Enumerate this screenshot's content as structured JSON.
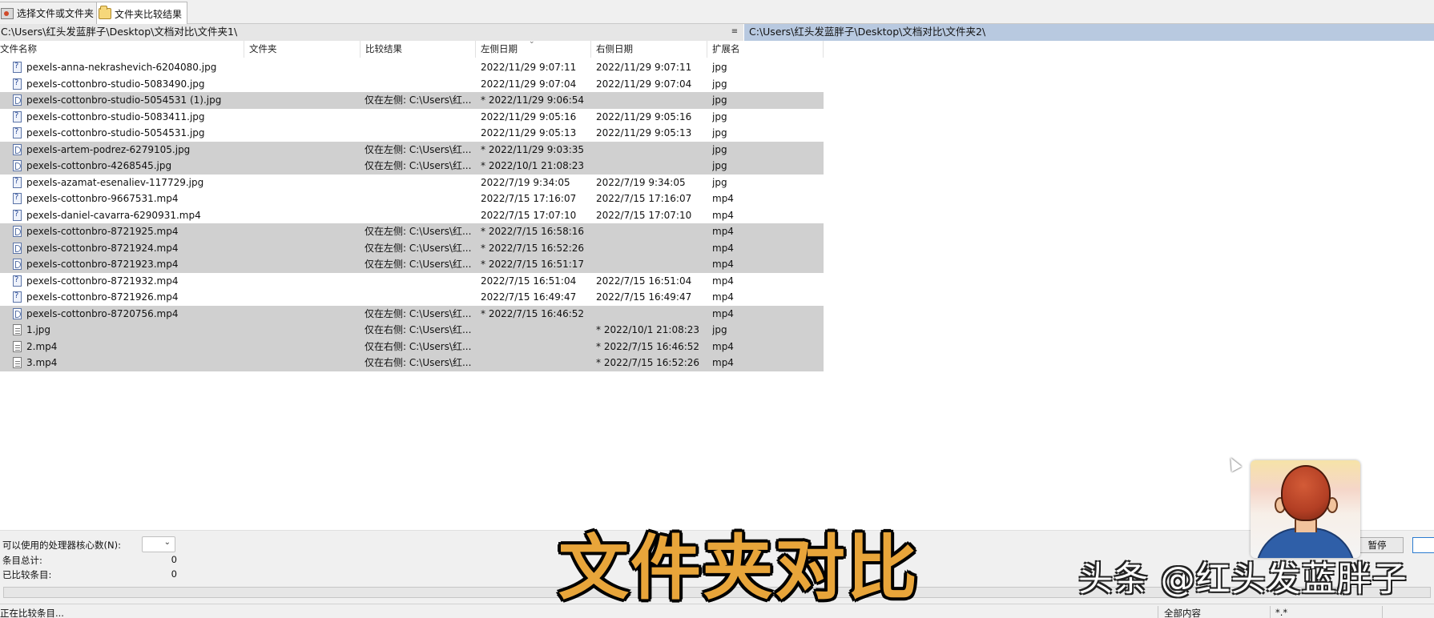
{
  "tabs": [
    {
      "label": "选择文件或文件夹",
      "icon": "selector-icon",
      "active": false
    },
    {
      "label": "文件夹比较结果",
      "icon": "folder-icon",
      "active": true
    }
  ],
  "paths": {
    "left": "C:\\Users\\红头发蓝胖子\\Desktop\\文档对比\\文件夹1\\",
    "separator": "≡",
    "right": "C:\\Users\\红头发蓝胖子\\Desktop\\文档对比\\文件夹2\\"
  },
  "columns": [
    "文件名称",
    "文件夹",
    "比较结果",
    "左侧日期",
    "右侧日期",
    "扩展名"
  ],
  "rows": [
    {
      "name": "pexels-anna-nekrashevich-6204080.jpg",
      "folder": "",
      "result": "",
      "left_date": "2022/11/29 9:07:11",
      "right_date": "2022/11/29 9:07:11",
      "ext": "jpg",
      "state": "same"
    },
    {
      "name": "pexels-cottonbro-studio-5083490.jpg",
      "folder": "",
      "result": "",
      "left_date": "2022/11/29 9:07:04",
      "right_date": "2022/11/29 9:07:04",
      "ext": "jpg",
      "state": "same"
    },
    {
      "name": "pexels-cottonbro-studio-5054531 (1).jpg",
      "folder": "",
      "result": "仅在左侧: C:\\Users\\红...",
      "left_date": "* 2022/11/29 9:06:54",
      "right_date": "",
      "ext": "jpg",
      "state": "left"
    },
    {
      "name": "pexels-cottonbro-studio-5083411.jpg",
      "folder": "",
      "result": "",
      "left_date": "2022/11/29 9:05:16",
      "right_date": "2022/11/29 9:05:16",
      "ext": "jpg",
      "state": "same"
    },
    {
      "name": "pexels-cottonbro-studio-5054531.jpg",
      "folder": "",
      "result": "",
      "left_date": "2022/11/29 9:05:13",
      "right_date": "2022/11/29 9:05:13",
      "ext": "jpg",
      "state": "same"
    },
    {
      "name": "pexels-artem-podrez-6279105.jpg",
      "folder": "",
      "result": "仅在左侧: C:\\Users\\红...",
      "left_date": "* 2022/11/29 9:03:35",
      "right_date": "",
      "ext": "jpg",
      "state": "left"
    },
    {
      "name": "pexels-cottonbro-4268545.jpg",
      "folder": "",
      "result": "仅在左侧: C:\\Users\\红...",
      "left_date": "* 2022/10/1 21:08:23",
      "right_date": "",
      "ext": "jpg",
      "state": "left"
    },
    {
      "name": "pexels-azamat-esenaliev-117729.jpg",
      "folder": "",
      "result": "",
      "left_date": "2022/7/19 9:34:05",
      "right_date": "2022/7/19 9:34:05",
      "ext": "jpg",
      "state": "same"
    },
    {
      "name": "pexels-cottonbro-9667531.mp4",
      "folder": "",
      "result": "",
      "left_date": "2022/7/15 17:16:07",
      "right_date": "2022/7/15 17:16:07",
      "ext": "mp4",
      "state": "same"
    },
    {
      "name": "pexels-daniel-cavarra-6290931.mp4",
      "folder": "",
      "result": "",
      "left_date": "2022/7/15 17:07:10",
      "right_date": "2022/7/15 17:07:10",
      "ext": "mp4",
      "state": "same"
    },
    {
      "name": "pexels-cottonbro-8721925.mp4",
      "folder": "",
      "result": "仅在左侧: C:\\Users\\红...",
      "left_date": "* 2022/7/15 16:58:16",
      "right_date": "",
      "ext": "mp4",
      "state": "left"
    },
    {
      "name": "pexels-cottonbro-8721924.mp4",
      "folder": "",
      "result": "仅在左侧: C:\\Users\\红...",
      "left_date": "* 2022/7/15 16:52:26",
      "right_date": "",
      "ext": "mp4",
      "state": "left"
    },
    {
      "name": "pexels-cottonbro-8721923.mp4",
      "folder": "",
      "result": "仅在左侧: C:\\Users\\红...",
      "left_date": "* 2022/7/15 16:51:17",
      "right_date": "",
      "ext": "mp4",
      "state": "left"
    },
    {
      "name": "pexels-cottonbro-8721932.mp4",
      "folder": "",
      "result": "",
      "left_date": "2022/7/15 16:51:04",
      "right_date": "2022/7/15 16:51:04",
      "ext": "mp4",
      "state": "same"
    },
    {
      "name": "pexels-cottonbro-8721926.mp4",
      "folder": "",
      "result": "",
      "left_date": "2022/7/15 16:49:47",
      "right_date": "2022/7/15 16:49:47",
      "ext": "mp4",
      "state": "same"
    },
    {
      "name": "pexels-cottonbro-8720756.mp4",
      "folder": "",
      "result": "仅在左侧: C:\\Users\\红...",
      "left_date": "* 2022/7/15 16:46:52",
      "right_date": "",
      "ext": "mp4",
      "state": "left"
    },
    {
      "name": "1.jpg",
      "folder": "",
      "result": "仅在右侧: C:\\Users\\红...",
      "left_date": "",
      "right_date": "* 2022/10/1 21:08:23",
      "ext": "jpg",
      "state": "right"
    },
    {
      "name": "2.mp4",
      "folder": "",
      "result": "仅在右侧: C:\\Users\\红...",
      "left_date": "",
      "right_date": "* 2022/7/15 16:46:52",
      "ext": "mp4",
      "state": "right"
    },
    {
      "name": "3.mp4",
      "folder": "",
      "result": "仅在右侧: C:\\Users\\红...",
      "left_date": "",
      "right_date": "* 2022/7/15 16:52:26",
      "ext": "mp4",
      "state": "right"
    }
  ],
  "bottom": {
    "cores_label": "可以使用的处理器核心数(N):",
    "cores_value": "",
    "total_label": "条目总计:",
    "total_value": "0",
    "compared_label": "已比较条目:",
    "compared_value": "0",
    "pause_label": "暂停",
    "status_text": "正在比较条目...",
    "status_filter": "全部内容",
    "status_mask": "*.*"
  },
  "overlay": {
    "caption": "文件夹对比",
    "watermark": "头条 @红头发蓝胖子"
  }
}
